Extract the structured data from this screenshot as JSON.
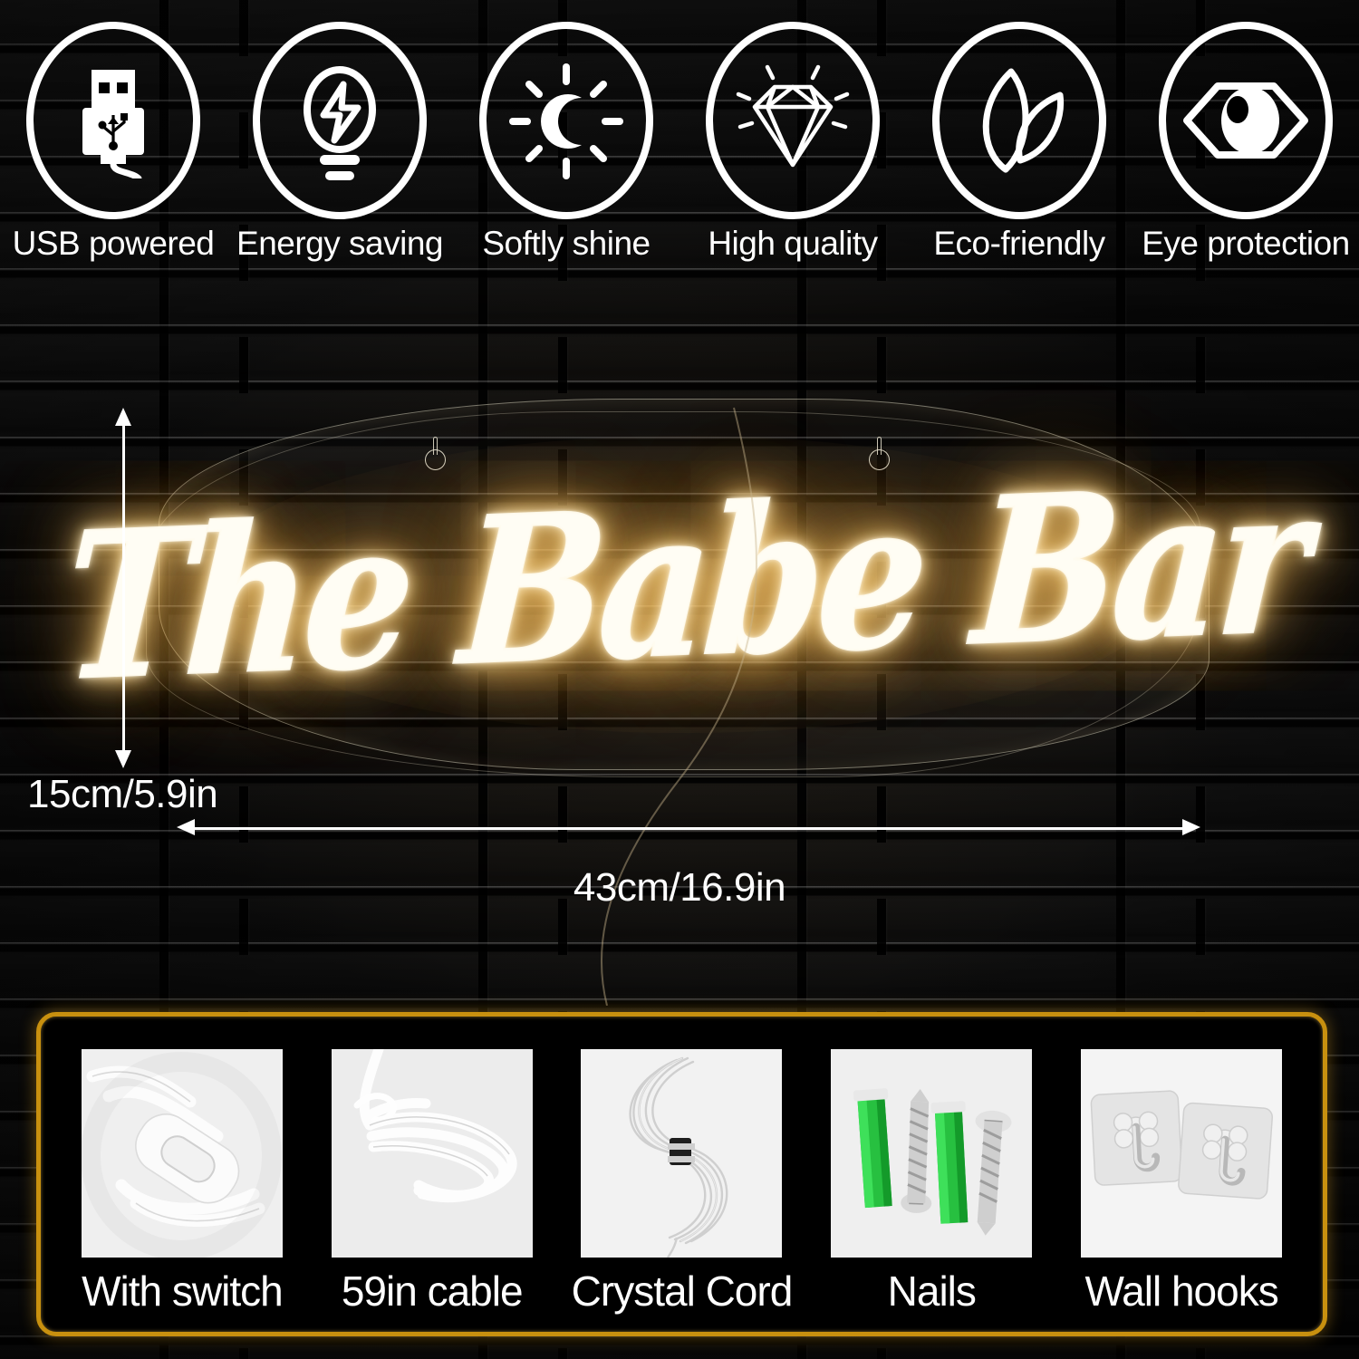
{
  "features": [
    {
      "icon": "usb-icon",
      "label": "USB powered"
    },
    {
      "icon": "bulb-bolt-icon",
      "label": "Energy saving"
    },
    {
      "icon": "moon-sun-icon",
      "label": "Softly shine"
    },
    {
      "icon": "diamond-icon",
      "label": "High quality"
    },
    {
      "icon": "leaves-icon",
      "label": "Eco-friendly"
    },
    {
      "icon": "eye-icon",
      "label": "Eye protection"
    }
  ],
  "product": {
    "sign_text": "The Babe Bar",
    "neon_color": "#fffdf4",
    "glow_color": "#ffc46a",
    "backing": "clear acrylic contour cut",
    "mount_holes": 2
  },
  "dimensions": {
    "height_label": "15cm/5.9in",
    "width_label": "43cm/16.9in"
  },
  "accessories": {
    "border_color": "#c8900f",
    "items": [
      {
        "label": "With switch",
        "thumb": "inline-cord-switch-photo"
      },
      {
        "label": "59in cable",
        "thumb": "coiled-white-cable-photo"
      },
      {
        "label": "Crystal Cord",
        "thumb": "clear-hanging-cord-photo"
      },
      {
        "label": "Nails",
        "thumb": "green-anchors-screws-photo"
      },
      {
        "label": "Wall hooks",
        "thumb": "adhesive-wall-hooks-photo"
      }
    ]
  }
}
